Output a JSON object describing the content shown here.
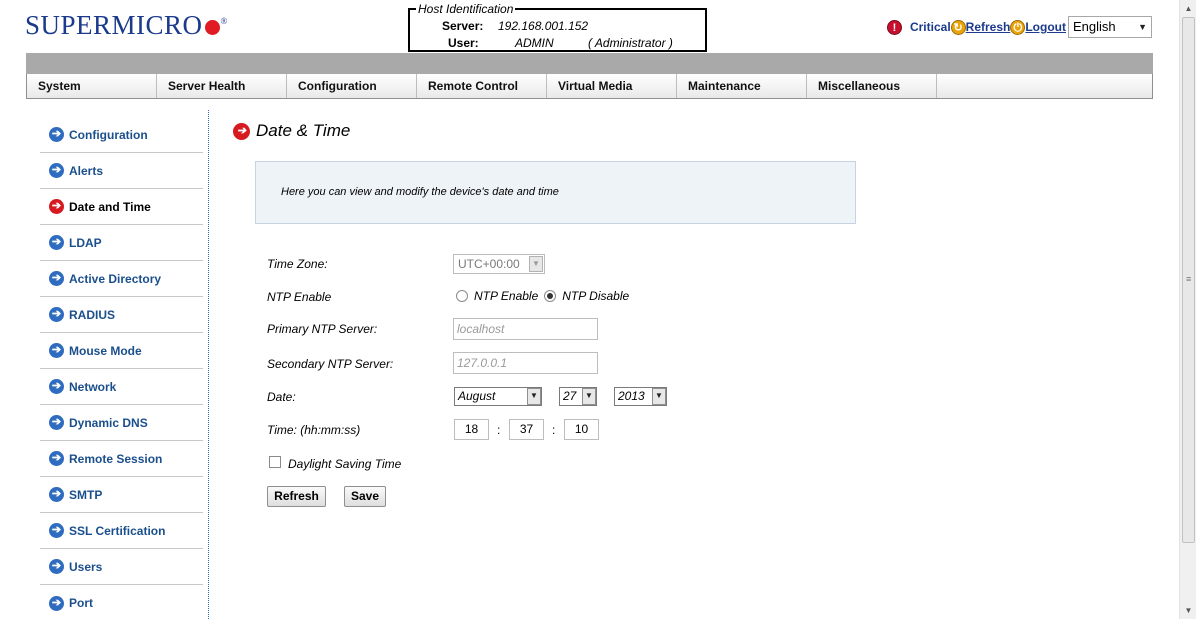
{
  "header": {
    "logo_text": "SUPERMICRO",
    "host_identification": {
      "legend": "Host Identification",
      "server_label": "Server:",
      "server_value": "192.168.001.152",
      "user_label": "User:",
      "user_value": "ADMIN",
      "user_role": "( Administrator )"
    },
    "critical_label": "Critical",
    "refresh_label": "Refresh",
    "logout_label": "Logout",
    "language": "English"
  },
  "menu": [
    "System",
    "Server Health",
    "Configuration",
    "Remote Control",
    "Virtual Media",
    "Maintenance",
    "Miscellaneous"
  ],
  "sidebar": {
    "items": [
      {
        "label": "Configuration"
      },
      {
        "label": "Alerts"
      },
      {
        "label": "Date and Time"
      },
      {
        "label": "LDAP"
      },
      {
        "label": "Active Directory"
      },
      {
        "label": "RADIUS"
      },
      {
        "label": "Mouse Mode"
      },
      {
        "label": "Network"
      },
      {
        "label": "Dynamic DNS"
      },
      {
        "label": "Remote Session"
      },
      {
        "label": "SMTP"
      },
      {
        "label": "SSL Certification"
      },
      {
        "label": "Users"
      },
      {
        "label": "Port"
      }
    ],
    "active": "Date and Time"
  },
  "main": {
    "title": "Date & Time",
    "description": "Here you can view and modify the device's date and time",
    "time_zone_label": "Time Zone:",
    "time_zone_value": "UTC+00:00",
    "ntp_enable_label": "NTP Enable",
    "ntp_option_enable": "NTP Enable",
    "ntp_option_disable": "NTP Disable",
    "ntp_selected": "NTP Disable",
    "primary_ntp_label": "Primary NTP Server:",
    "primary_ntp_placeholder": "localhost",
    "secondary_ntp_label": "Secondary NTP Server:",
    "secondary_ntp_placeholder": "127.0.0.1",
    "date_label": "Date:",
    "date_month": "August",
    "date_day": "27",
    "date_year": "2013",
    "time_label": "Time: (hh:mm:ss)",
    "time_hh": "18",
    "time_mm": "37",
    "time_ss": "10",
    "time_separator": ":",
    "daylight_label": "Daylight Saving Time",
    "daylight_checked": false,
    "refresh_button": "Refresh",
    "save_button": "Save"
  },
  "colors": {
    "brand_blue": "#1b3a8c",
    "link_blue": "#1b4f8c",
    "active_red": "#d71920",
    "nav_gray": "#a9a9a9"
  }
}
